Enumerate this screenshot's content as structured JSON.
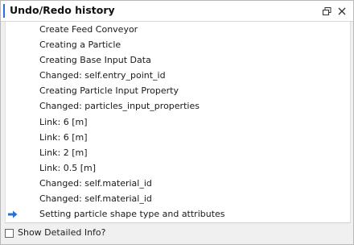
{
  "window": {
    "title": "Undo/Redo history",
    "restore_icon": "restore-icon",
    "close_icon": "close-icon",
    "accent": "#2b6fd4"
  },
  "history": {
    "items": [
      {
        "label": "Create Feed Conveyor"
      },
      {
        "label": "Creating a Particle"
      },
      {
        "label": "Creating Base Input Data"
      },
      {
        "label": "Changed: self.entry_point_id"
      },
      {
        "label": "Creating Particle Input Property"
      },
      {
        "label": "Changed: particles_input_properties"
      },
      {
        "label": "Link: 6 [m]"
      },
      {
        "label": "Link: 6 [m]"
      },
      {
        "label": "Link: 2 [m]"
      },
      {
        "label": "Link: 0.5 [m]"
      },
      {
        "label": "Changed: self.material_id"
      },
      {
        "label": "Changed: self.material_id"
      },
      {
        "label": "Setting particle shape type and attributes",
        "current": true,
        "icon": "arrow-right-icon"
      }
    ]
  },
  "footer": {
    "checkbox_label": "Show Detailed Info?",
    "checked": false
  }
}
